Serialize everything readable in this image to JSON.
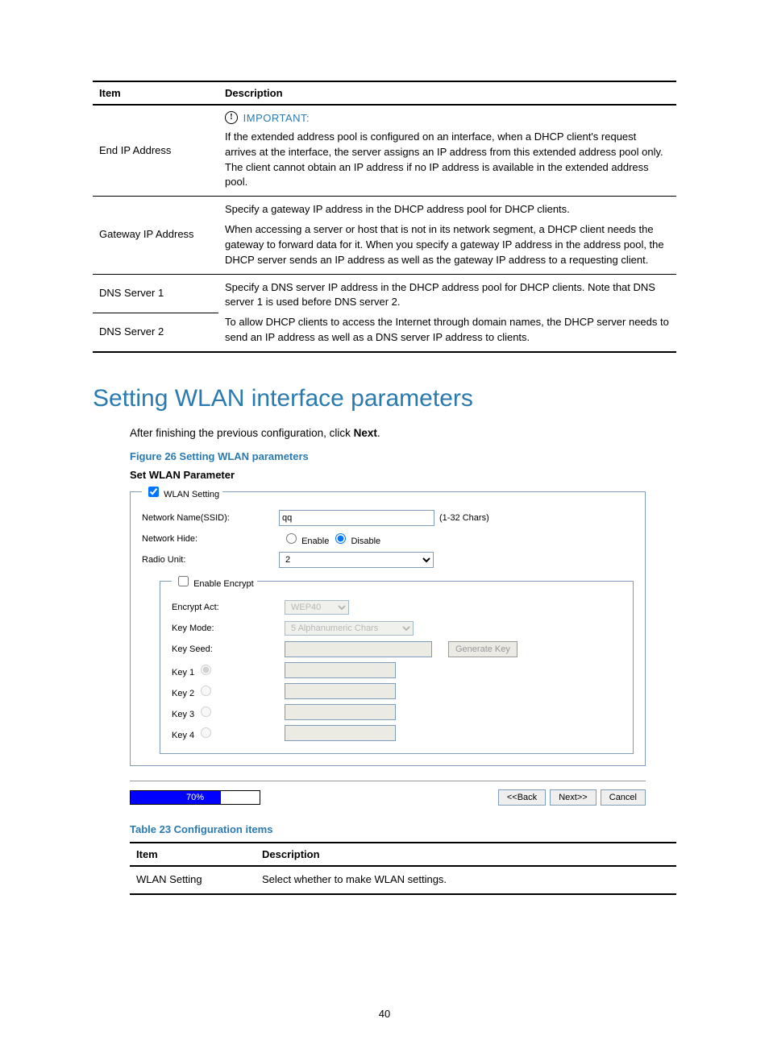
{
  "table1": {
    "head": {
      "item": "Item",
      "desc": "Description"
    },
    "rows": [
      {
        "item": "End IP Address",
        "important_label": "IMPORTANT:",
        "desc": "If the extended address pool is configured on an interface, when a DHCP client's request arrives at the interface, the server assigns an IP address from this extended address pool only. The client cannot obtain an IP address if no IP address is available in the extended address pool."
      },
      {
        "item": "Gateway IP Address",
        "desc_line1": "Specify a gateway IP address in the DHCP address pool for DHCP clients.",
        "desc_line2": "When accessing a server or host that is not in its network segment, a DHCP client needs the gateway to forward data for it. When you specify a gateway IP address in the address pool, the DHCP server sends an IP address as well as the gateway IP address to a requesting client."
      },
      {
        "item": "DNS Server 1",
        "shared_line1": "Specify a DNS server IP address in the DHCP address pool for DHCP clients. Note that DNS server 1 is used before DNS server 2."
      },
      {
        "item": "DNS Server 2",
        "shared_line2": "To allow DHCP clients to access the Internet through domain names, the DHCP server needs to send an IP address as well as a DNS server IP address to clients."
      }
    ]
  },
  "heading": "Setting WLAN interface parameters",
  "body_text": "After finishing the previous configuration, click ",
  "body_text_bold": "Next",
  "body_text_end": ".",
  "figure_caption": "Figure 26 Setting WLAN parameters",
  "wlan": {
    "panel_title": "Set WLAN Parameter",
    "wlan_setting_label": "WLAN Setting",
    "ssid_label": "Network Name(SSID):",
    "ssid_value": "qq",
    "ssid_hint": "(1-32 Chars)",
    "hide_label": "Network Hide:",
    "hide_enable": "Enable",
    "hide_disable": "Disable",
    "radio_label": "Radio Unit:",
    "radio_value": "2",
    "encrypt_legend": "Enable Encrypt",
    "encrypt_act_label": "Encrypt Act:",
    "encrypt_act_value": "WEP40",
    "key_mode_label": "Key Mode:",
    "key_mode_value": "5 Alphanumeric Chars",
    "key_seed_label": "Key Seed:",
    "gen_key_button": "Generate Key",
    "key1": "Key 1",
    "key2": "Key 2",
    "key3": "Key 3",
    "key4": "Key 4",
    "progress_pct": 70,
    "progress_text": "70%",
    "back_btn": "<<Back",
    "next_btn": "Next>>",
    "cancel_btn": "Cancel"
  },
  "table_caption": "Table 23 Configuration items",
  "table2": {
    "head": {
      "item": "Item",
      "desc": "Description"
    },
    "rows": [
      {
        "item": "WLAN Setting",
        "desc": "Select whether to make WLAN settings."
      }
    ]
  },
  "page_number": "40"
}
